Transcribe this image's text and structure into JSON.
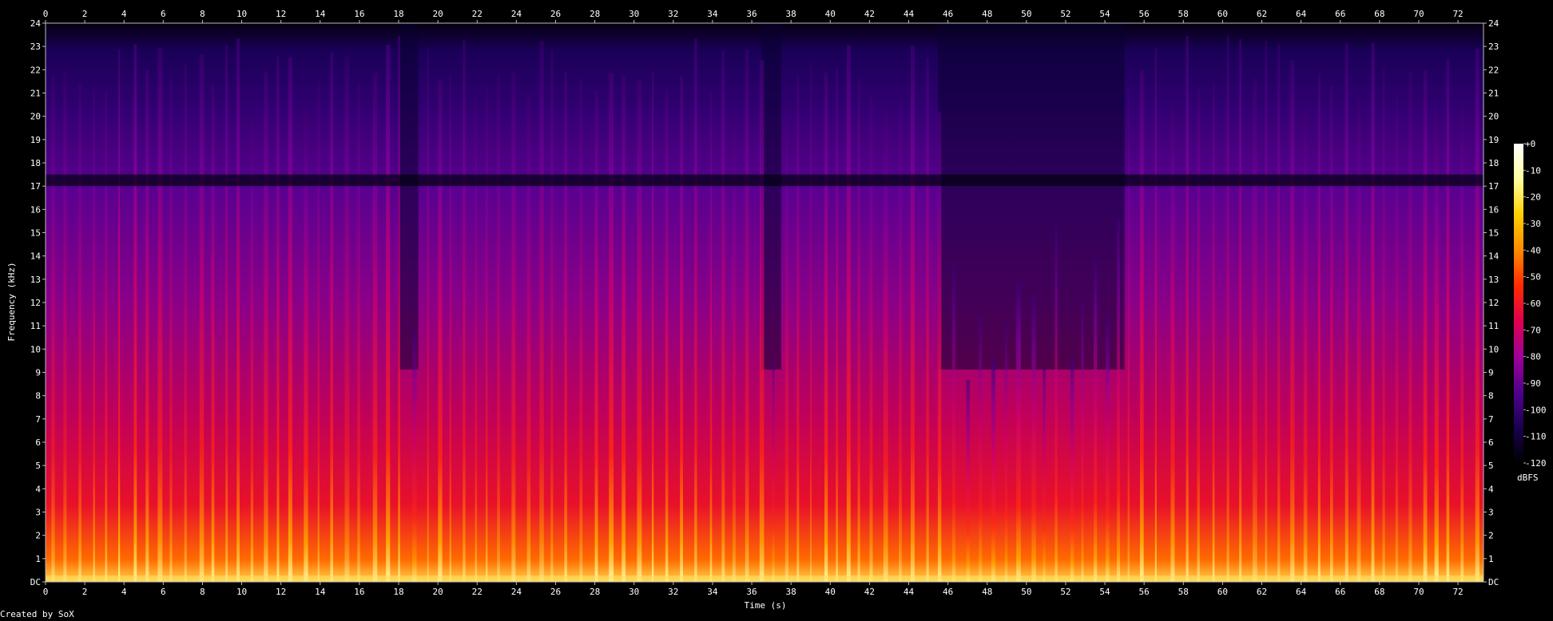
{
  "chart_data": {
    "type": "heatmap",
    "title": "",
    "xlabel": "Time (s)",
    "ylabel": "Frequency (kHz)",
    "x_ticks": [
      "0",
      "2",
      "4",
      "6",
      "8",
      "10",
      "12",
      "14",
      "16",
      "18",
      "20",
      "22",
      "24",
      "26",
      "28",
      "30",
      "32",
      "34",
      "36",
      "38",
      "40",
      "42",
      "44",
      "46",
      "48",
      "50",
      "52",
      "54",
      "56",
      "58",
      "60",
      "62",
      "64",
      "66",
      "68",
      "70",
      "72"
    ],
    "y_ticks": [
      "DC",
      "1",
      "2",
      "3",
      "4",
      "5",
      "6",
      "7",
      "8",
      "9",
      "10",
      "11",
      "12",
      "13",
      "14",
      "15",
      "16",
      "17",
      "18",
      "19",
      "20",
      "21",
      "22",
      "23",
      "24"
    ],
    "xlim": [
      0,
      73.3
    ],
    "ylim": [
      0,
      24
    ],
    "colorbar": {
      "label": "dBFS",
      "ticks": [
        "+0",
        "-10",
        "-20",
        "-30",
        "-40",
        "-50",
        "-60",
        "-70",
        "-80",
        "-90",
        "-100",
        "-110",
        "-120"
      ],
      "range": [
        -120,
        0
      ]
    },
    "colormap": [
      "#000000",
      "#1a0050",
      "#50008c",
      "#a0009a",
      "#e0004e",
      "#ff2a00",
      "#ff8a00",
      "#ffd000",
      "#ffffa0",
      "#ffffff"
    ],
    "quiet_sections_s": [
      [
        18,
        19
      ],
      [
        36.5,
        37.5
      ],
      [
        45.5,
        55
      ]
    ],
    "notch_band_khz": [
      17,
      17.5
    ]
  },
  "footer": {
    "credit": "Created by SoX"
  }
}
